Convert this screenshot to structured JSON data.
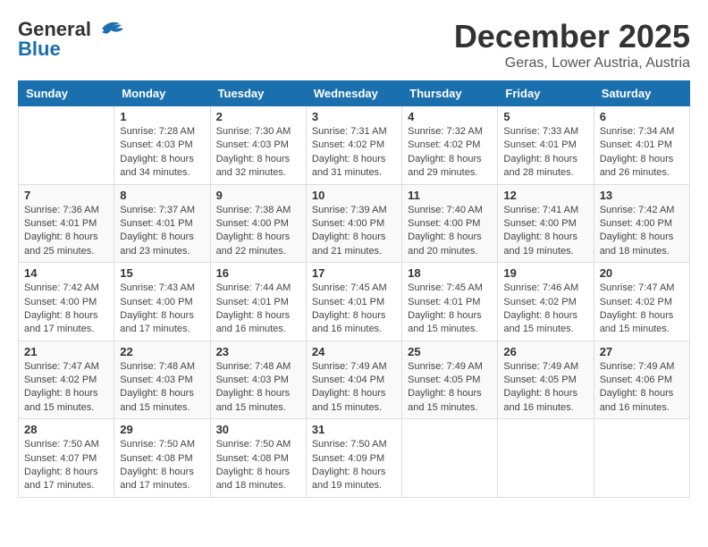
{
  "header": {
    "logo": {
      "line1": "General",
      "line2": "Blue"
    },
    "title": "December 2025",
    "location": "Geras, Lower Austria, Austria"
  },
  "calendar": {
    "days_of_week": [
      "Sunday",
      "Monday",
      "Tuesday",
      "Wednesday",
      "Thursday",
      "Friday",
      "Saturday"
    ],
    "weeks": [
      [
        {
          "day": "",
          "info": ""
        },
        {
          "day": "1",
          "info": "Sunrise: 7:28 AM\nSunset: 4:03 PM\nDaylight: 8 hours\nand 34 minutes."
        },
        {
          "day": "2",
          "info": "Sunrise: 7:30 AM\nSunset: 4:03 PM\nDaylight: 8 hours\nand 32 minutes."
        },
        {
          "day": "3",
          "info": "Sunrise: 7:31 AM\nSunset: 4:02 PM\nDaylight: 8 hours\nand 31 minutes."
        },
        {
          "day": "4",
          "info": "Sunrise: 7:32 AM\nSunset: 4:02 PM\nDaylight: 8 hours\nand 29 minutes."
        },
        {
          "day": "5",
          "info": "Sunrise: 7:33 AM\nSunset: 4:01 PM\nDaylight: 8 hours\nand 28 minutes."
        },
        {
          "day": "6",
          "info": "Sunrise: 7:34 AM\nSunset: 4:01 PM\nDaylight: 8 hours\nand 26 minutes."
        }
      ],
      [
        {
          "day": "7",
          "info": "Sunrise: 7:36 AM\nSunset: 4:01 PM\nDaylight: 8 hours\nand 25 minutes."
        },
        {
          "day": "8",
          "info": "Sunrise: 7:37 AM\nSunset: 4:01 PM\nDaylight: 8 hours\nand 23 minutes."
        },
        {
          "day": "9",
          "info": "Sunrise: 7:38 AM\nSunset: 4:00 PM\nDaylight: 8 hours\nand 22 minutes."
        },
        {
          "day": "10",
          "info": "Sunrise: 7:39 AM\nSunset: 4:00 PM\nDaylight: 8 hours\nand 21 minutes."
        },
        {
          "day": "11",
          "info": "Sunrise: 7:40 AM\nSunset: 4:00 PM\nDaylight: 8 hours\nand 20 minutes."
        },
        {
          "day": "12",
          "info": "Sunrise: 7:41 AM\nSunset: 4:00 PM\nDaylight: 8 hours\nand 19 minutes."
        },
        {
          "day": "13",
          "info": "Sunrise: 7:42 AM\nSunset: 4:00 PM\nDaylight: 8 hours\nand 18 minutes."
        }
      ],
      [
        {
          "day": "14",
          "info": "Sunrise: 7:42 AM\nSunset: 4:00 PM\nDaylight: 8 hours\nand 17 minutes."
        },
        {
          "day": "15",
          "info": "Sunrise: 7:43 AM\nSunset: 4:00 PM\nDaylight: 8 hours\nand 17 minutes."
        },
        {
          "day": "16",
          "info": "Sunrise: 7:44 AM\nSunset: 4:01 PM\nDaylight: 8 hours\nand 16 minutes."
        },
        {
          "day": "17",
          "info": "Sunrise: 7:45 AM\nSunset: 4:01 PM\nDaylight: 8 hours\nand 16 minutes."
        },
        {
          "day": "18",
          "info": "Sunrise: 7:45 AM\nSunset: 4:01 PM\nDaylight: 8 hours\nand 15 minutes."
        },
        {
          "day": "19",
          "info": "Sunrise: 7:46 AM\nSunset: 4:02 PM\nDaylight: 8 hours\nand 15 minutes."
        },
        {
          "day": "20",
          "info": "Sunrise: 7:47 AM\nSunset: 4:02 PM\nDaylight: 8 hours\nand 15 minutes."
        }
      ],
      [
        {
          "day": "21",
          "info": "Sunrise: 7:47 AM\nSunset: 4:02 PM\nDaylight: 8 hours\nand 15 minutes."
        },
        {
          "day": "22",
          "info": "Sunrise: 7:48 AM\nSunset: 4:03 PM\nDaylight: 8 hours\nand 15 minutes."
        },
        {
          "day": "23",
          "info": "Sunrise: 7:48 AM\nSunset: 4:03 PM\nDaylight: 8 hours\nand 15 minutes."
        },
        {
          "day": "24",
          "info": "Sunrise: 7:49 AM\nSunset: 4:04 PM\nDaylight: 8 hours\nand 15 minutes."
        },
        {
          "day": "25",
          "info": "Sunrise: 7:49 AM\nSunset: 4:05 PM\nDaylight: 8 hours\nand 15 minutes."
        },
        {
          "day": "26",
          "info": "Sunrise: 7:49 AM\nSunset: 4:05 PM\nDaylight: 8 hours\nand 16 minutes."
        },
        {
          "day": "27",
          "info": "Sunrise: 7:49 AM\nSunset: 4:06 PM\nDaylight: 8 hours\nand 16 minutes."
        }
      ],
      [
        {
          "day": "28",
          "info": "Sunrise: 7:50 AM\nSunset: 4:07 PM\nDaylight: 8 hours\nand 17 minutes."
        },
        {
          "day": "29",
          "info": "Sunrise: 7:50 AM\nSunset: 4:08 PM\nDaylight: 8 hours\nand 17 minutes."
        },
        {
          "day": "30",
          "info": "Sunrise: 7:50 AM\nSunset: 4:08 PM\nDaylight: 8 hours\nand 18 minutes."
        },
        {
          "day": "31",
          "info": "Sunrise: 7:50 AM\nSunset: 4:09 PM\nDaylight: 8 hours\nand 19 minutes."
        },
        {
          "day": "",
          "info": ""
        },
        {
          "day": "",
          "info": ""
        },
        {
          "day": "",
          "info": ""
        }
      ]
    ]
  }
}
